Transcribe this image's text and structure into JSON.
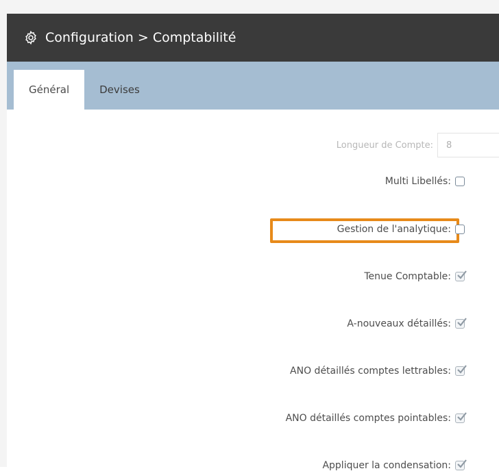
{
  "header": {
    "title": "Configuration > Comptabilité",
    "icon": "gear-icon"
  },
  "tabs": [
    {
      "label": "Général",
      "active": true
    },
    {
      "label": "Devises",
      "active": false
    }
  ],
  "form": {
    "account_length": {
      "label": "Longueur de Compte:",
      "value": "8"
    },
    "fields": [
      {
        "label": "Multi Libellés:",
        "checked": false
      },
      {
        "label": "Gestion de l'analytique:",
        "checked": false,
        "highlighted": true
      },
      {
        "label": "Tenue Comptable:",
        "checked": true
      },
      {
        "label": "A-nouveaux détaillés:",
        "checked": true
      },
      {
        "label": "ANO détaillés comptes lettrables:",
        "checked": true
      },
      {
        "label": "ANO détaillés comptes pointables:",
        "checked": true
      },
      {
        "label": "Appliquer la condensation:",
        "checked": true
      }
    ]
  },
  "colors": {
    "header_bg": "#3a3a3a",
    "tabbar_bg": "#a5bdd2",
    "highlight": "#e78a1a"
  }
}
